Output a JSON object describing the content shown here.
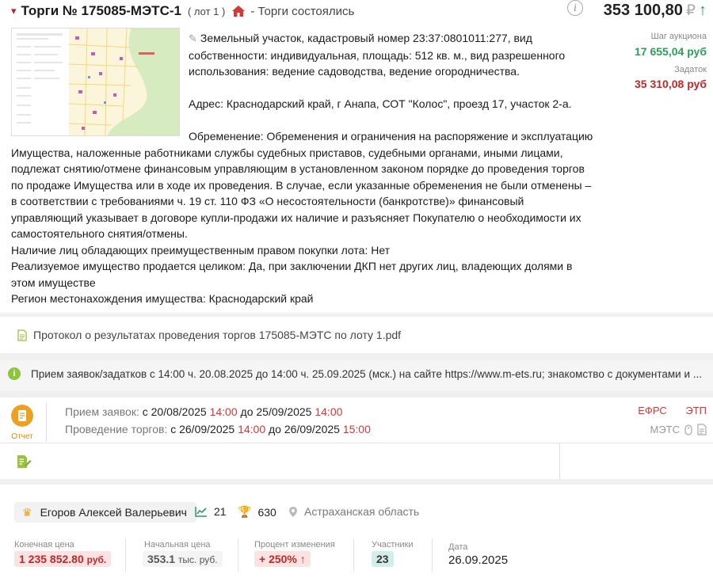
{
  "header": {
    "title": "Торги № 175085-МЭТС-1",
    "lot": "( лот 1 )",
    "status": "- Торги состоялись",
    "price": "353 100,80",
    "currency_symbol": "₽"
  },
  "side": {
    "step_label": "Шаг аукциона",
    "step_value": "17 655,04 руб",
    "deposit_label": "Задаток",
    "deposit_value": "35 310,08 руб"
  },
  "description": {
    "line1": "Земельный участок, кадастровый номер 23:37:0801011:277, вид собственности: индивидуальная, площадь: 512 кв. м., вид разрешенного использования: ведение садоводства, ведение огородничества.",
    "address": "Адрес: Краснодарский край, г Анапа, СОТ \"Колос\", проезд 17, участок 2-а.",
    "encumbrance": "Обременение: Обременения и ограничения на распоряжение и эксплуатацию Имущества, наложенные работниками службы судебных приставов, судебными органами, иными лицами, подлежат снятию/отмене финансовым управляющим в установленном законом порядке до проведения торгов по продаже Имущества или в ходе их проведения. В случае, если указанные обременения не были отменены – в соответствии с требованиями ч. 19 ст. 110 ФЗ «О несостоятельности (банкротстве)» финансовый управляющий указывает в договоре купли-продажи их наличие и разъясняет Покупателю о необходимости их самостоятельного снятия/отмены.",
    "preemptive": "Наличие лиц обладающих преимущественным правом покупки лота: Нет",
    "whole": "Реализуемое имущество продается целиком: Да, при заключении ДКП нет других лиц, владеющих долями в этом имуществе",
    "region": "Регион местонахождения имущества: Краснодарский край"
  },
  "document": {
    "label": "Протокол о результатах проведения торгов 175085-МЭТС по лоту 1.pdf"
  },
  "notice": {
    "text": "Прием заявок/задатков с 14:00 ч. 20.08.2025 до 14:00 ч. 25.09.2025 (мск.) на сайте https://www.m-ets.ru; знакомство с документами и ..."
  },
  "dates": {
    "report_label": "Отчет",
    "applications_label": "Прием заявок:",
    "app_from_word": "с",
    "app_from_date": "20/08/2025",
    "app_from_time": "14:00",
    "app_to_word": "до",
    "app_to_date": "25/09/2025",
    "app_to_time": "14:00",
    "trading_label": "Проведение торгов:",
    "tr_from_word": "с",
    "tr_from_date": "26/09/2025",
    "tr_from_time": "14:00",
    "tr_to_word": "до",
    "tr_to_date": "26/09/2025",
    "tr_to_time": "15:00",
    "efrs": "ЕФРС",
    "etp": "ЭТП",
    "platform": "МЭТС"
  },
  "winner": {
    "name": "Егоров Алексей Валерьевич",
    "views": "21",
    "score": "630",
    "region": "Астраханская область"
  },
  "metrics": {
    "final_label": "Конечная цена",
    "final_value": "1 235 852.80",
    "final_unit": "руб.",
    "start_label": "Начальная цена",
    "start_value": "353.1",
    "start_unit": "тыс. руб.",
    "change_label": "Процент изменения",
    "change_value": "+ 250%",
    "participants_label": "Участники",
    "participants_value": "23",
    "date_label": "Дата",
    "date_value": "26.09.2025"
  },
  "colors": {
    "accent_red": "#d43838",
    "green": "#2aa05a",
    "orange": "#f0a020",
    "teal_badge": "#d3eee8",
    "red_badge": "#fbe3e3"
  }
}
